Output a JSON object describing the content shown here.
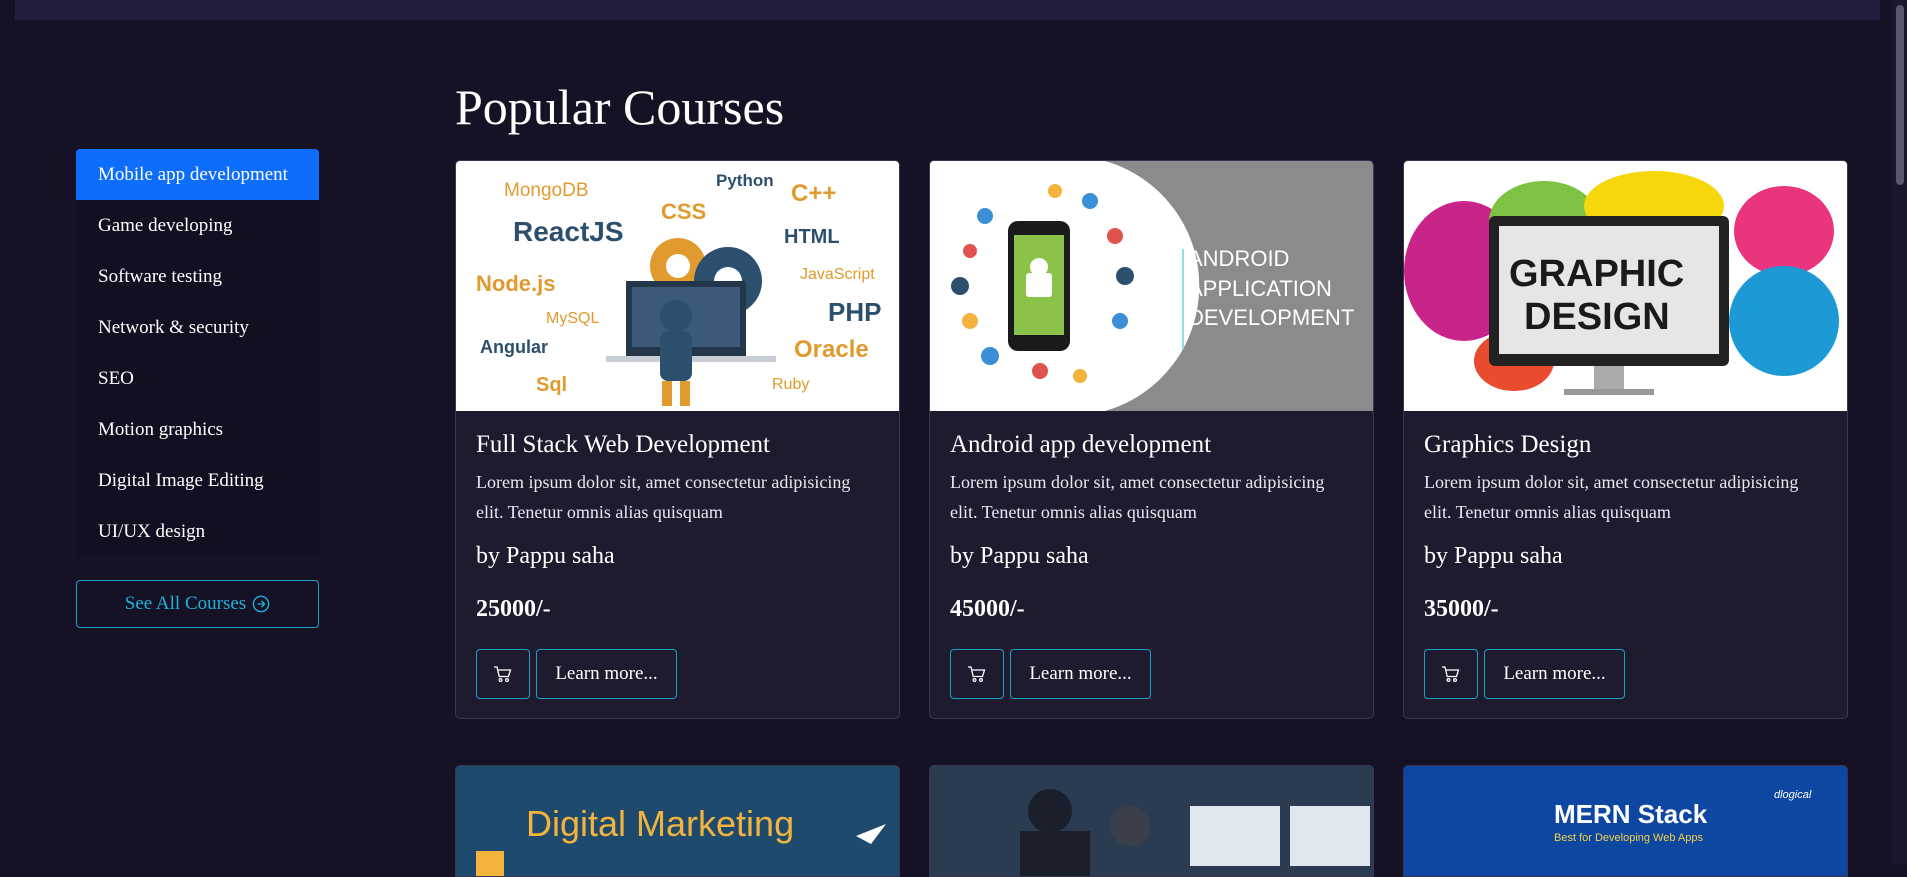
{
  "heading": "Popular Courses",
  "sidebar": {
    "items": [
      {
        "label": "Mobile app development"
      },
      {
        "label": "Game developing"
      },
      {
        "label": "Software testing"
      },
      {
        "label": "Network & security"
      },
      {
        "label": "SEO"
      },
      {
        "label": "Motion graphics"
      },
      {
        "label": "Digital Image Editing"
      },
      {
        "label": "UI/UX design"
      }
    ],
    "see_all": "See All Courses"
  },
  "cards": [
    {
      "title": "Full Stack Web Development",
      "text": "Lorem ipsum dolor sit, amet consectetur adipisicing elit. Tenetur omnis alias quisquam",
      "author": "by Pappu saha",
      "price": "25000/-",
      "learn": "Learn more...",
      "img_words": [
        "MongoDB",
        "Python",
        "C++",
        "ReactJS",
        "CSS",
        "HTML",
        "JavaScript",
        "Node.js",
        "MySQL",
        "PHP",
        "Angular",
        "Oracle",
        "Sql",
        "Ruby"
      ]
    },
    {
      "title": "Android app development",
      "text": "Lorem ipsum dolor sit, amet consectetur adipisicing elit. Tenetur omnis alias quisquam",
      "author": "by Pappu saha",
      "price": "45000/-",
      "learn": "Learn more...",
      "img_words": [
        "ANDROID",
        "APPLICATION",
        "DEVELOPMENT"
      ]
    },
    {
      "title": "Graphics Design",
      "text": "Lorem ipsum dolor sit, amet consectetur adipisicing elit. Tenetur omnis alias quisquam",
      "author": "by Pappu saha",
      "price": "35000/-",
      "learn": "Learn more...",
      "img_words": [
        "GRAPHIC",
        "DESIGN"
      ]
    }
  ],
  "row2": [
    {
      "img_words": [
        "Digital Marketing"
      ]
    },
    {
      "img_words": []
    },
    {
      "img_words": [
        "MERN Stack",
        "Best for Developing Web Apps",
        "dlogical"
      ]
    }
  ],
  "colors": {
    "accent": "#0d6efd",
    "outline": "#17a2c8",
    "background": "#151225",
    "card": "#1e1b2e"
  }
}
